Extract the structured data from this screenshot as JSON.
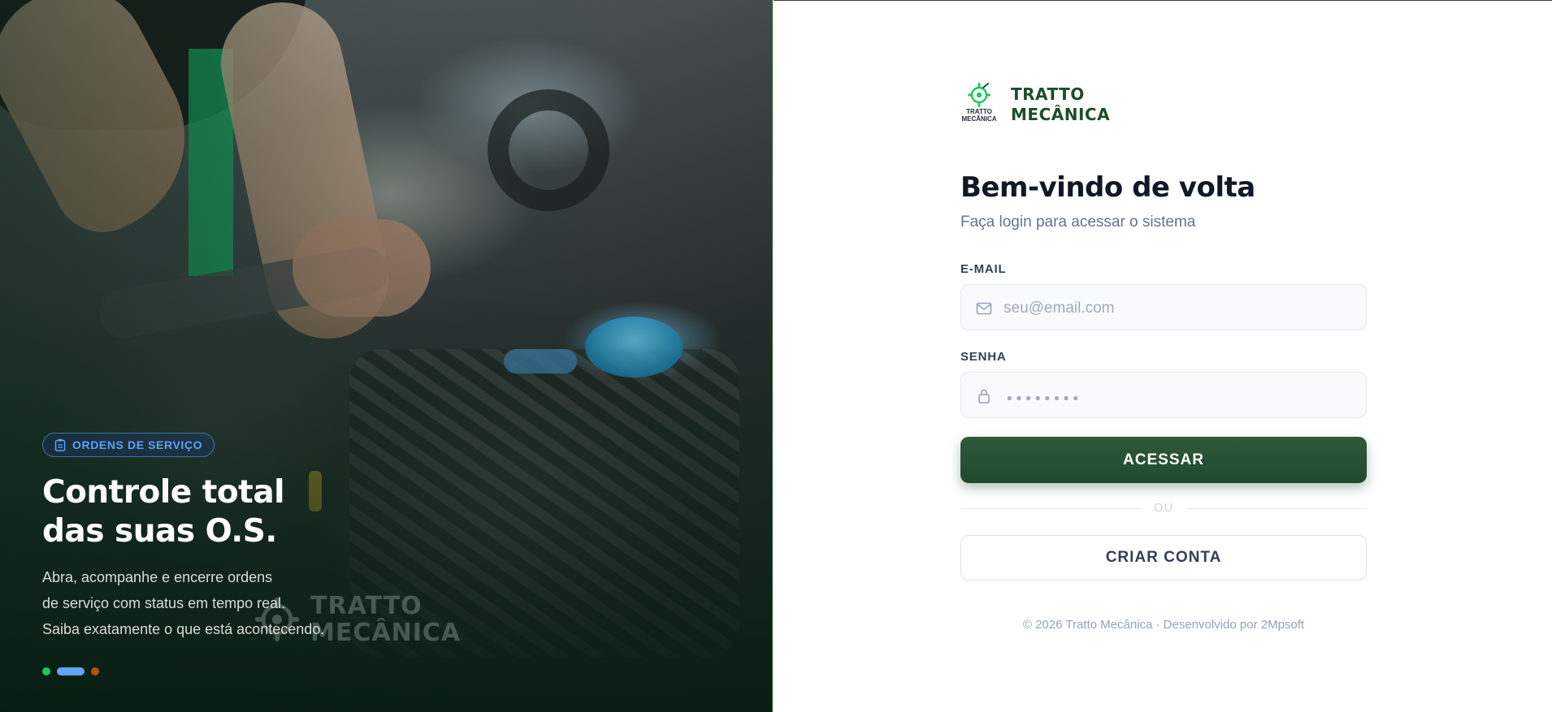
{
  "hero": {
    "badge_icon": "clipboard-icon",
    "badge_label": "ORDENS DE SERVIÇO",
    "title_line1": "Controle total",
    "title_line2": "das suas O.S.",
    "desc_line1": "Abra, acompanhe e encerre ordens",
    "desc_line2": "de serviço com status em tempo real.",
    "desc_line3": "Saiba exatamente o que está acontecendo.",
    "watermark_line1": "TRATTO",
    "watermark_line2": "MECÂNICA",
    "carousel": {
      "active_index": 1,
      "dots": [
        "#22c55e",
        "#60a5fa",
        "#b45309"
      ]
    }
  },
  "brand": {
    "logo_text_line1": "TRATTO",
    "logo_text_line2": "MECÂNICA",
    "name_line1": "TRATTO",
    "name_line2": "MECÂNICA",
    "logo_color": "#22c55e"
  },
  "login": {
    "title": "Bem-vindo de volta",
    "subtitle": "Faça login para acessar o sistema",
    "email_label": "E-MAIL",
    "email_icon": "mail-icon",
    "email_placeholder": "seu@email.com",
    "password_label": "SENHA",
    "password_icon": "lock-icon",
    "password_placeholder": "••••••••",
    "submit_label": "ACESSAR",
    "divider_label": "OU",
    "create_account_label": "CRIAR CONTA"
  },
  "footer": {
    "text": "© 2026 Tratto Mecânica  ·  Desenvolvido por 2Mpsoft"
  },
  "colors": {
    "primary": "#214a2d",
    "accent_blue": "#5aa2f5",
    "brand_green": "#1d4d2c"
  }
}
